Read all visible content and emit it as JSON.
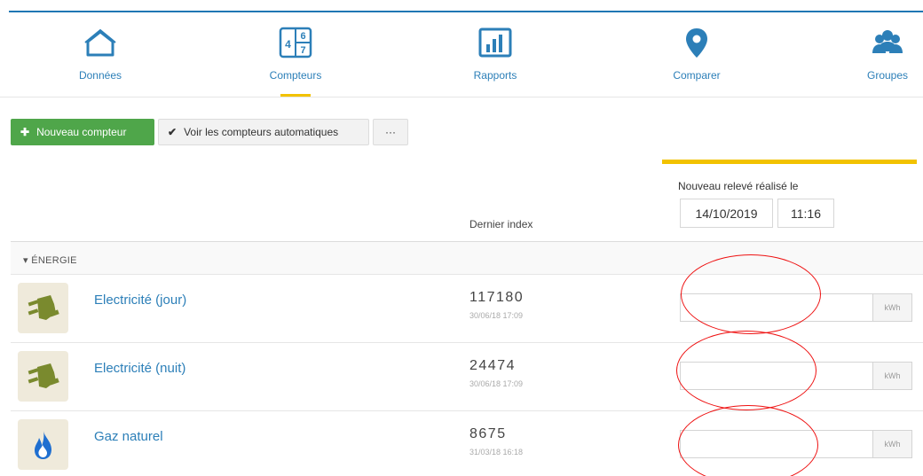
{
  "nav": {
    "items": [
      {
        "label": "Données",
        "icon": "house-icon"
      },
      {
        "label": "Compteurs",
        "icon": "counter-digits-icon",
        "active": true
      },
      {
        "label": "Rapports",
        "icon": "bar-chart-icon"
      },
      {
        "label": "Comparer",
        "icon": "map-pin-icon"
      },
      {
        "label": "Groupes",
        "icon": "users-icon"
      }
    ],
    "counter_digits": [
      "4",
      "6",
      "7"
    ],
    "accent": "#2c7fb8",
    "active_underline": "#f2c200"
  },
  "toolbar": {
    "new_meter_label": "Nouveau compteur",
    "auto_meters_label": "Voir les compteurs automatiques",
    "more_label": "···",
    "primary_color": "#4fa64a"
  },
  "reading": {
    "label": "Nouveau relevé réalisé le",
    "date": "14/10/2019",
    "time": "11:16"
  },
  "table": {
    "last_index_header": "Dernier index"
  },
  "group": {
    "label": "ÉNERGIE",
    "caret": "▾"
  },
  "meters": [
    {
      "name": "Electricité (jour)",
      "icon": "plug-icon",
      "index": "117180",
      "date": "30/06/18 17:09",
      "input_value": "",
      "unit": "kWh"
    },
    {
      "name": "Electricité (nuit)",
      "icon": "plug-icon",
      "index": "24474",
      "date": "30/06/18 17:09",
      "input_value": "",
      "unit": "kWh"
    },
    {
      "name": "Gaz naturel",
      "icon": "flame-icon",
      "index": "8675",
      "date": "31/03/18 16:18",
      "input_value": "",
      "unit": "kWh"
    }
  ],
  "annotation_color": "#e11111"
}
